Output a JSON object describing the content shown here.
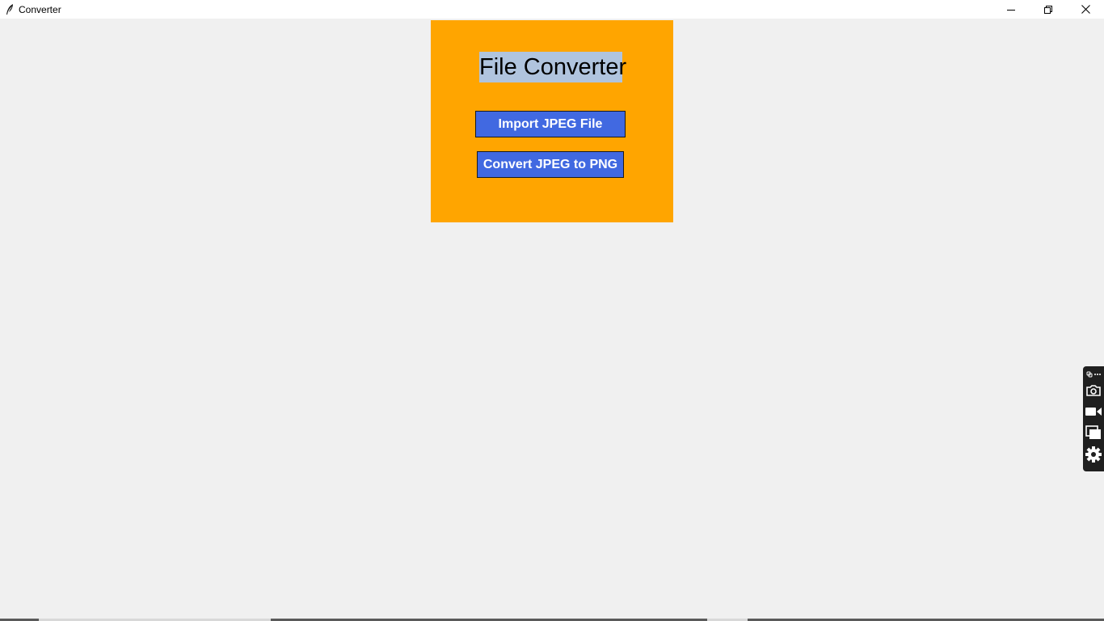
{
  "window": {
    "title": "Converter",
    "controls": [
      "minimize-icon",
      "restore-icon",
      "close-icon"
    ]
  },
  "panel": {
    "background": "#ffa500",
    "heading": "File Converter",
    "heading_background": "#b0c4de",
    "buttons": {
      "import_label": "Import JPEG File",
      "convert_label": "Convert JPEG to PNG"
    },
    "button_color": "#4169e1"
  },
  "side_toolbar": {
    "icons": [
      "link-icon",
      "more-icon",
      "camera-icon",
      "video-icon",
      "window-icon",
      "gear-icon"
    ]
  }
}
